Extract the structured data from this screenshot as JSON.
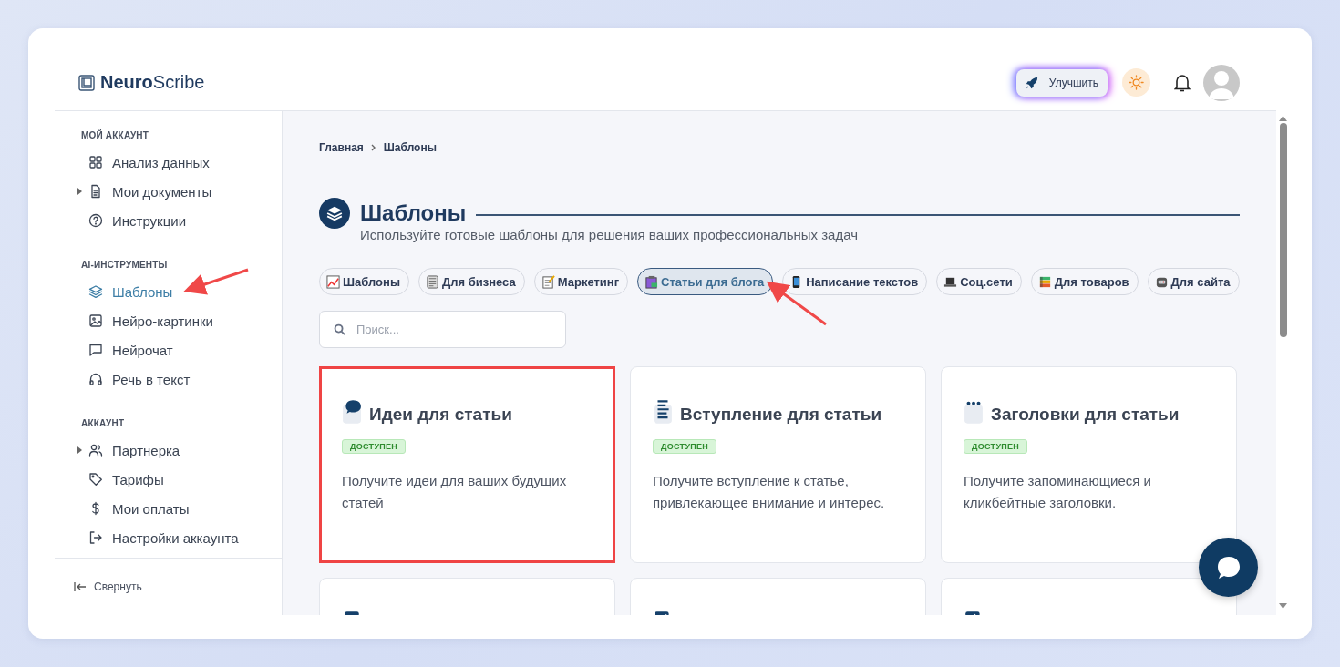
{
  "app": {
    "logo": "**Neuro**Scribe"
  },
  "header": {
    "upgrade_button": "Улучшить"
  },
  "sidebar": {
    "sections": [
      {
        "title": "МОЙ АККАУНТ",
        "items": [
          {
            "label": "Анализ данных",
            "has_children": false,
            "selected": false
          },
          {
            "label": "Мои документы",
            "has_children": true,
            "selected": false
          },
          {
            "label": "Инструкции",
            "has_children": false,
            "selected": false
          }
        ]
      },
      {
        "title": "AI-ИНСТРУМЕНТЫ",
        "items": [
          {
            "label": "Шаблоны",
            "has_children": false,
            "selected": true
          },
          {
            "label": "Нейро-картинки",
            "has_children": false,
            "selected": false
          },
          {
            "label": "Нейрочат",
            "has_children": false,
            "selected": false
          },
          {
            "label": "Речь в текст",
            "has_children": false,
            "selected": false
          }
        ]
      },
      {
        "title": "АККАУНТ",
        "items": [
          {
            "label": "Партнерка",
            "has_children": true,
            "selected": false
          },
          {
            "label": "Тарифы",
            "has_children": false,
            "selected": false
          },
          {
            "label": "Мои оплаты",
            "has_children": false,
            "selected": false
          },
          {
            "label": "Настройки аккаунта",
            "has_children": false,
            "selected": false
          }
        ]
      }
    ],
    "collapse": "Свернуть"
  },
  "breadcrumb": [
    "Главная",
    "Шаблоны"
  ],
  "page": {
    "title": "Шаблоны",
    "subtitle": "Используйте готовые шаблоны для решения ваших профессиональных задач"
  },
  "filters": [
    {
      "label": "Шаблоны",
      "selected": false
    },
    {
      "label": "Для бизнеса",
      "selected": false
    },
    {
      "label": "Маркетинг",
      "selected": false
    },
    {
      "label": "Статьи для блога",
      "selected": true
    },
    {
      "label": "Написание текстов",
      "selected": false
    },
    {
      "label": "Соц.сети",
      "selected": false
    },
    {
      "label": "Для товаров",
      "selected": false
    },
    {
      "label": "Для сайта",
      "selected": false
    }
  ],
  "search": {
    "placeholder": "Поиск..."
  },
  "cards": [
    {
      "kind": "full",
      "title": "Идеи для статьи",
      "badge": "ДОСТУПЕН",
      "description": "Получите идеи для ваших будущих статей",
      "highlighted": true
    },
    {
      "kind": "full",
      "title": "Вступление для статьи",
      "badge": "ДОСТУПЕН",
      "description": "Получите вступление к статье, привлекающее внимание и интерес.",
      "highlighted": false
    },
    {
      "kind": "full",
      "title": "Заголовки для статьи",
      "badge": "ДОСТУПЕН",
      "description": "Получите запоминающиеся и кликбейтные заголовки.",
      "highlighted": false
    },
    {
      "kind": "cut",
      "highlighted": false
    },
    {
      "kind": "cut",
      "highlighted": false
    },
    {
      "kind": "cut",
      "highlighted": false
    }
  ]
}
